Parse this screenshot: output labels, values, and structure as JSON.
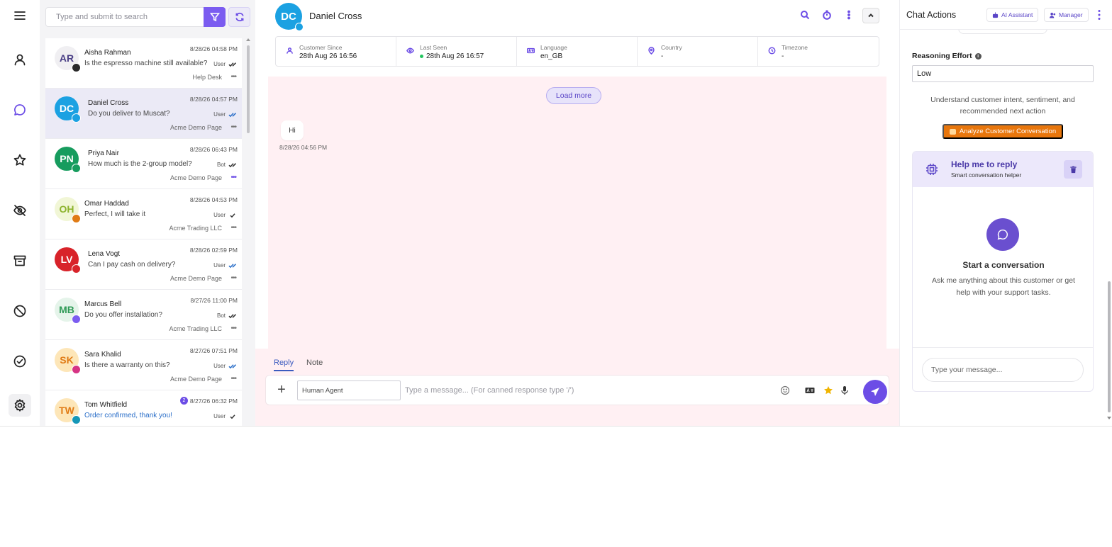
{
  "search": {
    "placeholder": "Type and submit to search"
  },
  "conversations": [
    {
      "initials": "AR",
      "name": "Aisha Rahman",
      "time": "8/28/26 04:58 PM",
      "preview": "Is the espresso machine still available?",
      "sender": "User",
      "source": "Help Desk",
      "avatar_bg": "#f0eff2",
      "avatar_fg": "#4a3f86",
      "badge_color": "#2a2a2a"
    },
    {
      "initials": "DC",
      "name": "Daniel Cross",
      "time": "8/28/26 04:57 PM",
      "preview": "Do you deliver to Muscat?",
      "sender": "User",
      "source": "Acme Demo Page",
      "avatar_bg": "#1ba1e2",
      "avatar_fg": "#ffffff",
      "badge_color": "#1ba1e2"
    },
    {
      "initials": "PN",
      "name": "Priya Nair",
      "time": "8/28/26 06:43 PM",
      "preview": "How much is the 2-group model?",
      "sender": "Bot",
      "source": "Acme Demo Page",
      "avatar_bg": "#179c5e",
      "avatar_fg": "#ffffff",
      "badge_color": "#179c5e"
    },
    {
      "initials": "OH",
      "name": "Omar Haddad",
      "time": "8/28/26 04:53 PM",
      "preview": "Perfect, I will take it",
      "sender": "User",
      "source": "Acme Trading LLC",
      "avatar_bg": "#f1f6d6",
      "avatar_fg": "#8db32d",
      "badge_color": "#e07b15"
    },
    {
      "initials": "LV",
      "name": "Lena Vogt",
      "time": "8/28/26 02:59 PM",
      "preview": "Can I pay cash on delivery?",
      "sender": "User",
      "source": "Acme Demo Page",
      "avatar_bg": "#d8232a",
      "avatar_fg": "#ffffff",
      "badge_color": "#d8232a"
    },
    {
      "initials": "MB",
      "name": "Marcus Bell",
      "time": "8/27/26 11:00 PM",
      "preview": "Do you offer installation?",
      "sender": "Bot",
      "source": "Acme Trading LLC",
      "avatar_bg": "#e5f4ea",
      "avatar_fg": "#2f9a56",
      "badge_color": "#7b5cf0"
    },
    {
      "initials": "SK",
      "name": "Sara Khalid",
      "time": "8/27/26 07:51 PM",
      "preview": "Is there a warranty on this?",
      "sender": "User",
      "source": "Acme Demo Page",
      "avatar_bg": "#fde6b8",
      "avatar_fg": "#e07b15",
      "badge_color": "#d63384"
    },
    {
      "initials": "TW",
      "name": "Tom Whitfield",
      "time": "8/27/26 06:32 PM",
      "preview": "Order confirmed, thank you!",
      "sender": "User",
      "source": "Acme Trading LLC",
      "avatar_bg": "#fde6b8",
      "avatar_fg": "#e07b15",
      "badge_color": "#1597b7",
      "unread": "2"
    }
  ],
  "chat": {
    "initials": "DC",
    "name": "Daniel Cross",
    "info": [
      {
        "label": "Customer Since",
        "value": "28th Aug 26 16:56",
        "icon": "user-icon"
      },
      {
        "label": "Last Seen",
        "value": "28th Aug 26 16:57",
        "icon": "eye-icon"
      },
      {
        "label": "Language",
        "value": "en_GB",
        "icon": "language-icon"
      },
      {
        "label": "Country",
        "value": "-",
        "icon": "map-pin-icon"
      },
      {
        "label": "Timezone",
        "value": "-",
        "icon": "clock-icon"
      }
    ],
    "load_more": "Load more",
    "message": {
      "text": "Hi",
      "time": "8/28/26 04:56 PM"
    },
    "tabs": {
      "reply": "Reply",
      "note": "Note"
    },
    "agent_value": "Human Agent",
    "message_placeholder": "Type a message... (For canned response type '/')"
  },
  "right_panel": {
    "title": "Chat Actions",
    "ai_assistant": "AI Assistant",
    "manager": "Manager",
    "reasoning_label": "Reasoning Effort",
    "reasoning_value": "Low",
    "analyze_desc": "Understand customer intent, sentiment, and recommended next action",
    "analyze_button": "Analyze Customer Conversation",
    "helper_title": "Help me to reply",
    "helper_subtitle": "Smart conversation helper",
    "start_title": "Start a conversation",
    "start_desc": "Ask me anything about this customer or get help with your support tasks.",
    "helper_placeholder": "Type your message..."
  },
  "colors": {
    "accent": "#6c4de6",
    "message_bg": "#fff0f3",
    "analyze": "#e8760c"
  }
}
